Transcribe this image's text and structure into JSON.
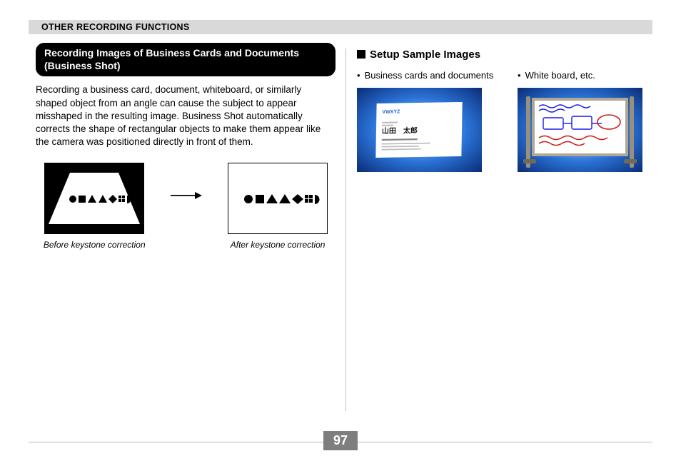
{
  "header": {
    "title": "OTHER RECORDING FUNCTIONS"
  },
  "left": {
    "section_title": "Recording Images of Business Cards and Documents (Business Shot)",
    "body": "Recording a business card, document, whiteboard, or similarly shaped object from an angle can cause the subject to appear misshaped in the resulting image. Business Shot automatically corrects the shape of rectangular objects to make them appear like the camera was positioned directly in front of them.",
    "caption_before": "Before keystone correction",
    "caption_after": "After keystone correction"
  },
  "right": {
    "setup_heading": "Setup Sample Images",
    "sample1_label": "Business cards and documents",
    "sample1_brand": "VWXYZ",
    "sample1_name": "山田　太郎",
    "sample2_label": "White board, etc."
  },
  "footer": {
    "page": "97"
  }
}
